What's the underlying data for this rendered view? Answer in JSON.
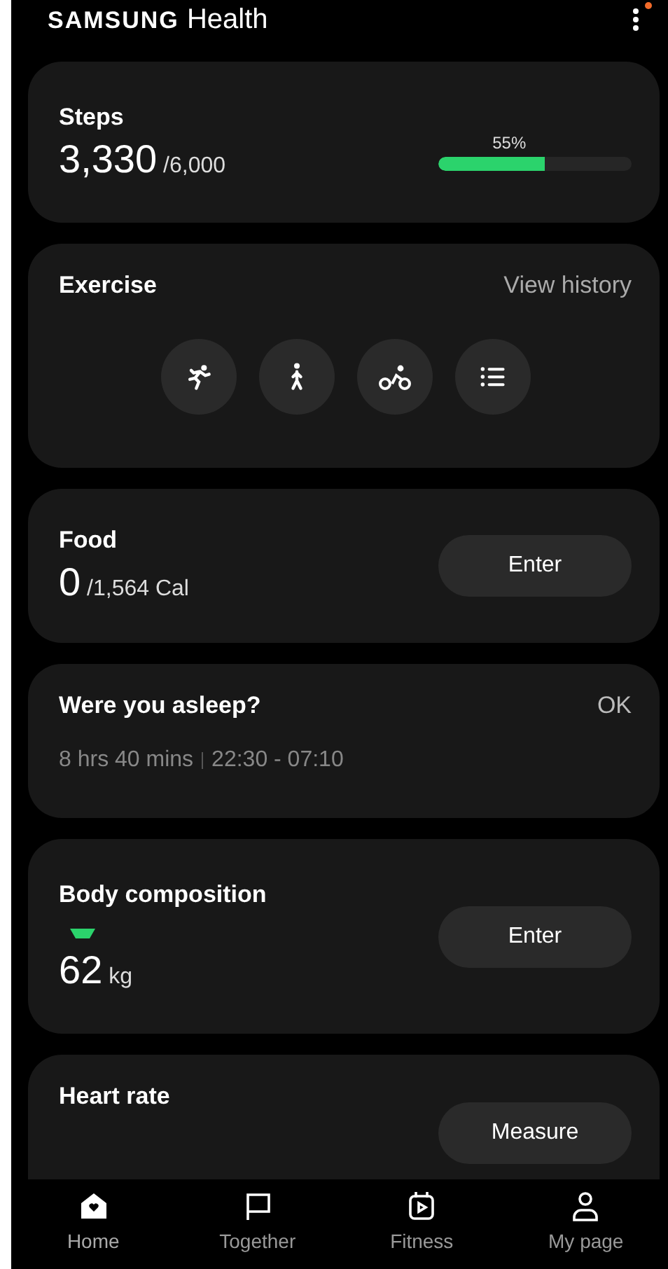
{
  "header": {
    "brand": "SAMSUNG",
    "title": "Health",
    "notification_dot": true
  },
  "steps": {
    "title": "Steps",
    "value": "3,330",
    "goal": "/6,000",
    "percent": "55%",
    "level": 0.55
  },
  "exercise": {
    "title": "Exercise",
    "link": "View history",
    "activities": [
      {
        "kind": "run"
      },
      {
        "kind": "walk"
      },
      {
        "kind": "bike"
      },
      {
        "kind": "list"
      }
    ]
  },
  "food": {
    "title": "Food",
    "value": "0",
    "goal": "/1,564 Cal",
    "button": "Enter"
  },
  "sleep": {
    "title": "Were you asleep?",
    "action": "OK",
    "duration": "8 hrs 40 mins",
    "range": "22:30 - 07:10"
  },
  "body": {
    "title": "Body composition",
    "value": "62",
    "unit": "kg",
    "button": "Enter"
  },
  "heart": {
    "title": "Heart rate",
    "button": "Measure"
  },
  "nav": [
    {
      "label": "Home",
      "kind": "home",
      "selected": true
    },
    {
      "label": "Together",
      "kind": "flag",
      "selected": false
    },
    {
      "label": "Fitness",
      "kind": "fitness",
      "selected": false
    },
    {
      "label": "My page",
      "kind": "person",
      "selected": false
    }
  ]
}
